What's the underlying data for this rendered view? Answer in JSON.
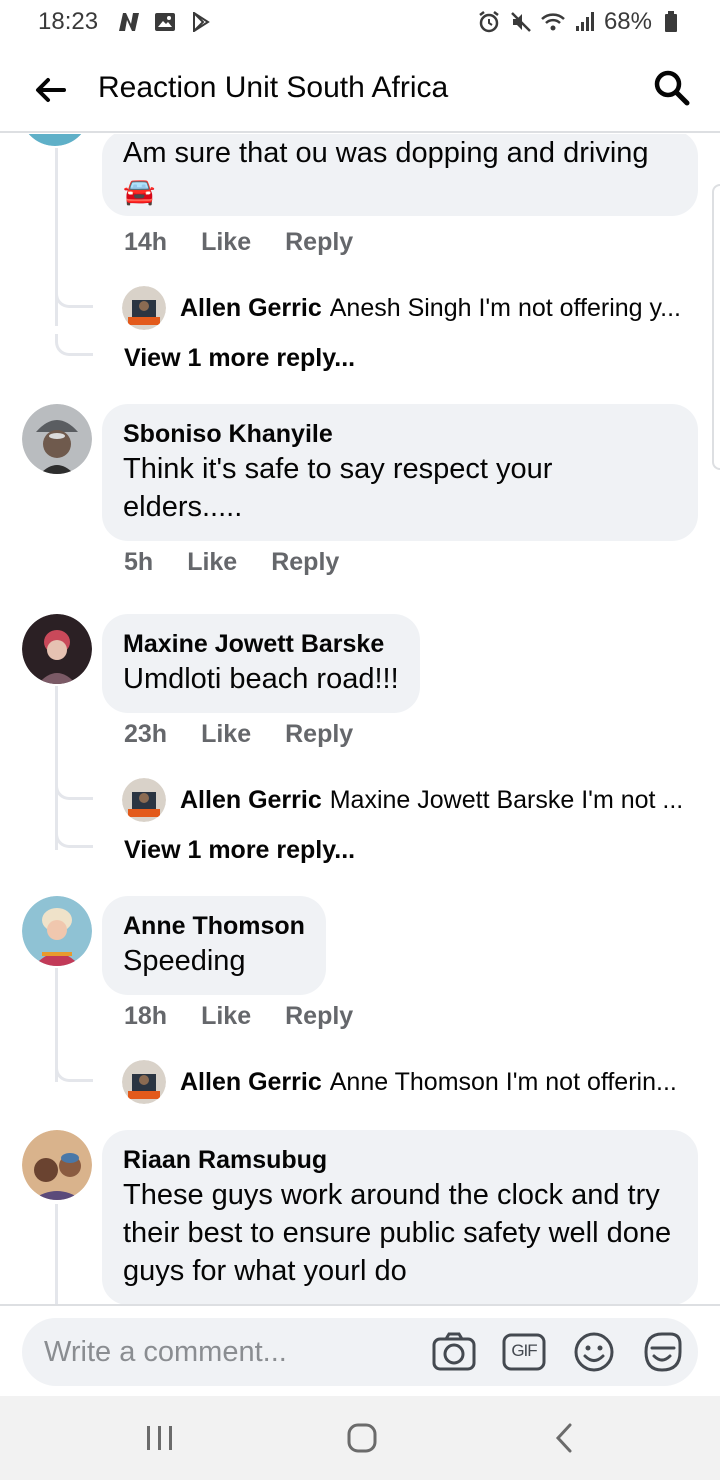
{
  "status_bar": {
    "time": "18:23",
    "battery": "68%"
  },
  "header": {
    "title": "Reaction Unit South Africa"
  },
  "comments": [
    {
      "text": "Am sure that ou was dopping and driving",
      "emoji": "🚘",
      "time": "14h",
      "like": "Like",
      "reply": "Reply",
      "reply_preview": {
        "name": "Allen Gerric",
        "text": "Anesh Singh I'm not offering y..."
      },
      "view_more": "View 1 more reply..."
    },
    {
      "author": "Sboniso Khanyile",
      "text": "Think it's safe to say respect your elders.....",
      "time": "5h",
      "like": "Like",
      "reply": "Reply"
    },
    {
      "author": "Maxine Jowett Barske",
      "text": "Umdloti beach road!!!",
      "time": "23h",
      "like": "Like",
      "reply": "Reply",
      "reply_preview": {
        "name": "Allen Gerric",
        "text": "Maxine Jowett Barske I'm not ..."
      },
      "view_more": "View 1 more reply..."
    },
    {
      "author": "Anne Thomson",
      "text": "Speeding",
      "time": "18h",
      "like": "Like",
      "reply": "Reply",
      "reply_preview": {
        "name": "Allen Gerric",
        "text": "Anne Thomson I'm not offerin..."
      }
    },
    {
      "author": "Riaan Ramsubug",
      "text": "These guys work around the clock and try their best to ensure public safety well done guys for what yourl do"
    }
  ],
  "composer": {
    "placeholder": "Write a comment...",
    "gif_label": "GIF"
  },
  "colors": {
    "bubble": "#f0f2f5",
    "meta": "#65676b",
    "divider": "#dddfe2"
  }
}
